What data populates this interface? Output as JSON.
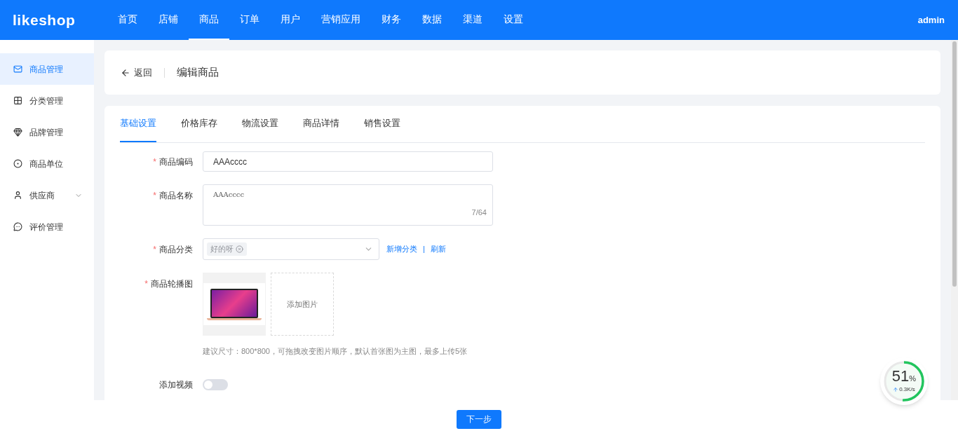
{
  "header": {
    "logo": "likeshop",
    "nav": [
      {
        "label": "首页",
        "selected": false
      },
      {
        "label": "店铺",
        "selected": false
      },
      {
        "label": "商品",
        "selected": true
      },
      {
        "label": "订单",
        "selected": false
      },
      {
        "label": "用户",
        "selected": false
      },
      {
        "label": "营销应用",
        "selected": false
      },
      {
        "label": "财务",
        "selected": false
      },
      {
        "label": "数据",
        "selected": false
      },
      {
        "label": "渠道",
        "selected": false
      },
      {
        "label": "设置",
        "selected": false
      }
    ],
    "user": "admin"
  },
  "sidebar": {
    "items": [
      {
        "label": "商品管理",
        "kind": "mail",
        "selected": true
      },
      {
        "label": "分类管理",
        "kind": "grid",
        "selected": false
      },
      {
        "label": "品牌管理",
        "kind": "gem",
        "selected": false
      },
      {
        "label": "商品单位",
        "kind": "target",
        "selected": false
      },
      {
        "label": "供应商",
        "kind": "user",
        "selected": false,
        "expanded": false
      },
      {
        "label": "评价管理",
        "kind": "chat",
        "selected": false
      }
    ]
  },
  "page_header": {
    "back": "返回",
    "title": "编辑商品"
  },
  "tabs": [
    {
      "label": "基础设置",
      "selected": true
    },
    {
      "label": "价格库存",
      "selected": false
    },
    {
      "label": "物流设置",
      "selected": false
    },
    {
      "label": "商品详情",
      "selected": false
    },
    {
      "label": "销售设置",
      "selected": false
    }
  ],
  "form": {
    "code": {
      "required": "*",
      "label": "商品编码",
      "value": "AAAcccc"
    },
    "name": {
      "required": "*",
      "label": "商品名称",
      "value": "AAAcccc",
      "count": "7/64"
    },
    "category": {
      "required": "*",
      "label": "商品分类",
      "tag": "好的呀",
      "links": [
        "新增分类",
        "刷新"
      ],
      "separator": "|"
    },
    "images": {
      "required": "*",
      "label": "商品轮播图",
      "add": "添加图片",
      "hint": "建议尺寸：800*800，可拖拽改变图片顺序，默认首张图为主图，最多上传5张"
    },
    "video": {
      "label": "添加视频",
      "on": false
    }
  },
  "footer": {
    "next": "下一步"
  },
  "monitor": {
    "percent": "51",
    "unit": "%",
    "speed": "0.3K/s",
    "level": 0.51
  }
}
